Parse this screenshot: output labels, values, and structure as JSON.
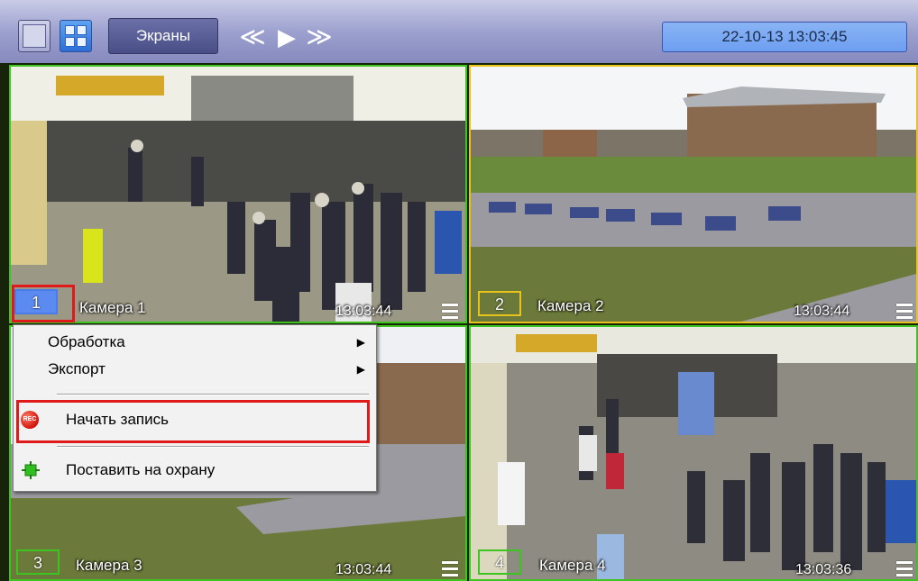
{
  "toolbar": {
    "screens_label": "Экраны",
    "nav_rewind_glyph": "≪",
    "nav_play_glyph": "▶",
    "nav_forward_glyph": "≫",
    "datetime": "22-10-13  13:03:45"
  },
  "cameras": [
    {
      "number": "1",
      "name": "Камера 1",
      "time": "13:03:44",
      "frame_color": "#3ec41e",
      "badge_color": "#4a7be8"
    },
    {
      "number": "2",
      "name": "Камера 2",
      "time": "13:03:44",
      "frame_color": "#e8c41b",
      "badge_color": "#e8c41b"
    },
    {
      "number": "3",
      "name": "Камера 3",
      "time": "13:03:44",
      "frame_color": "#3ec41e",
      "badge_color": "#3ec41e"
    },
    {
      "number": "4",
      "name": "Камера 4",
      "time": "13:03:36",
      "frame_color": "#3ec41e",
      "badge_color": "#3ec41e"
    }
  ],
  "context_menu": {
    "items": [
      {
        "label": "Обработка",
        "submenu": "▶"
      },
      {
        "label": "Экспорт",
        "submenu": "▶"
      },
      {
        "label": "Начать запись",
        "icon": "rec-icon",
        "icon_text": "REC"
      },
      {
        "label": "Поставить на охрану",
        "icon": "arm-icon"
      }
    ]
  },
  "colors": {
    "toolbar": "#9da1cf",
    "clock_bg": "#7aa8f3",
    "highlight": "#e01a1a",
    "rec": "#d2130a"
  }
}
